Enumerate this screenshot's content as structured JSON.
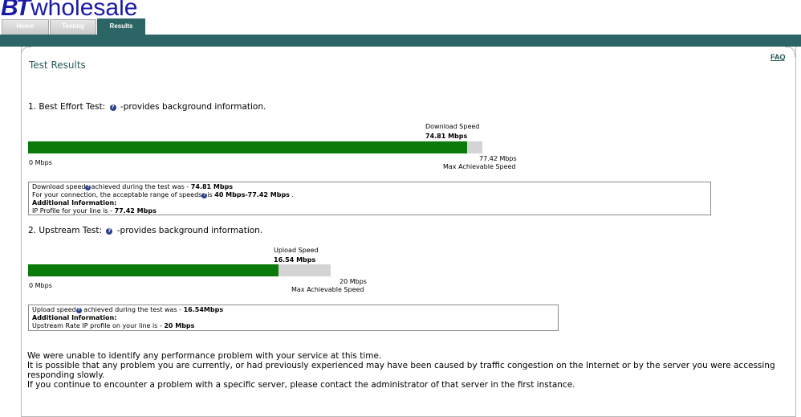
{
  "brand": {
    "logo_bt": "BT",
    "logo_word": "wholesale",
    "color": "#1a1aa6"
  },
  "tabs": [
    {
      "label": "Home"
    },
    {
      "label": "Testing"
    },
    {
      "label": "Results",
      "active": true
    }
  ],
  "accent": "#2c6565",
  "faq_label": "FAQ",
  "page_title": "Test Results",
  "best_effort": {
    "heading": "1. Best Effort Test:",
    "heading_suffix": "-provides background information.",
    "marker_title": "Download Speed",
    "marker_value": "74.81 Mbps",
    "min_label": "0 Mbps",
    "max_value": "77.42 Mbps",
    "max_label": "Max Achievable Speed",
    "fill_fraction": 0.9663,
    "info": {
      "line1_prefix": "Download speed",
      "line1_mid": "achieved during the test was - ",
      "line1_value": "74.81 Mbps",
      "line2_prefix": "For your connection, the acceptable range of speeds",
      "line2_mid": "is ",
      "line2_value": "40 Mbps-77.42 Mbps",
      "line2_end": " .",
      "line3": "Additional Information:",
      "line4_prefix": "IP Profile for your line is - ",
      "line4_value": "77.42 Mbps"
    }
  },
  "upstream": {
    "heading": "2. Upstream Test:",
    "heading_suffix": "-provides background information.",
    "marker_title": "Upload Speed",
    "marker_value": "16.54 Mbps",
    "min_label": "0 Mbps",
    "max_value": "20 Mbps",
    "max_label": "Max Achievable Speed",
    "fill_fraction": 0.827,
    "info": {
      "line1_prefix": "Upload speed",
      "line1_mid": " achieved during the test was - ",
      "line1_value": "16.54Mbps",
      "line2": "Additional Information:",
      "line3_prefix": "Upstream Rate IP profile on your line is - ",
      "line3_value": "20 Mbps"
    }
  },
  "summary": [
    "We were unable to identify any performance problem with your service at this time.",
    "It is possible that any problem you are currently, or had previously experienced may have been caused by traffic congestion on the Internet or by the server you were accessing",
    "responding slowly.",
    "If you continue to encounter a problem with a specific server, please contact the administrator of that server in the first instance."
  ]
}
